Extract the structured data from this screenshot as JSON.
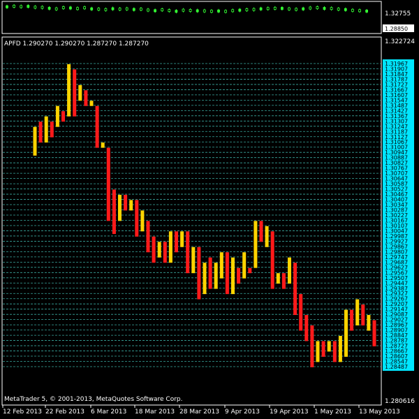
{
  "theme": {
    "background": "#000000",
    "grid": "#3aa9a0",
    "up": "#ffd400",
    "down": "#ff1a1a",
    "indicator_up": "#33ff33",
    "price_axis_bg": "#00e5ff"
  },
  "indicator_panel": {
    "axis_labels": [
      "1.32755",
      "1.28850"
    ],
    "range": [
      1.2865,
      1.3285
    ],
    "values": [
      1.3265,
      1.3275,
      1.3268,
      1.3272,
      1.3258,
      1.3255,
      1.324,
      1.323,
      1.325,
      1.3245,
      1.3235,
      1.3248,
      1.323,
      1.3225,
      1.3218,
      1.3232,
      1.3226,
      1.323,
      1.322,
      1.3225,
      1.321,
      1.32,
      1.3214,
      1.3202,
      1.319,
      1.3208,
      1.3204,
      1.3198,
      1.3196,
      1.319,
      1.3194,
      1.3188,
      1.32,
      1.3208,
      1.3215,
      1.322,
      1.323,
      1.3235,
      1.324,
      1.3238,
      1.323,
      1.3222,
      1.323,
      1.3244,
      1.325,
      1.3238,
      1.3236,
      1.3225,
      1.3218,
      1.3206,
      1.32,
      1.3193
    ]
  },
  "main_panel": {
    "header": "APFD 1.290270 1.290270 1.287270 1.287270",
    "axis_top_label": "1.322724",
    "axis_bottom_label": "1.280616",
    "copyright": "MetaTrader 5, © 2001-2013, MetaQuotes Software Corp."
  },
  "chart_data": {
    "type": "bar",
    "title": "",
    "symbol": "APFD",
    "ylim": [
      1.280616,
      1.322724
    ],
    "price_ticks": [
      "1.31967",
      "1.31907",
      "1.31847",
      "1.31787",
      "1.31727",
      "1.31667",
      "1.31607",
      "1.31547",
      "1.31487",
      "1.31427",
      "1.31367",
      "1.31307",
      "1.31247",
      "1.31187",
      "1.31127",
      "1.31067",
      "1.31007",
      "1.30947",
      "1.30887",
      "1.30827",
      "1.30767",
      "1.30707",
      "1.30647",
      "1.30587",
      "1.30527",
      "1.30467",
      "1.30407",
      "1.30347",
      "1.30287",
      "1.30227",
      "1.30167",
      "1.30107",
      "1.30047",
      "1.29987",
      "1.29927",
      "1.29867",
      "1.29807",
      "1.29747",
      "1.29687",
      "1.29627",
      "1.29567",
      "1.29507",
      "1.29447",
      "1.29387",
      "1.29327",
      "1.29267",
      "1.29207",
      "1.29147",
      "1.29087",
      "1.29027",
      "1.28967",
      "1.28907",
      "1.28847",
      "1.28787",
      "1.28727",
      "1.28667",
      "1.28607",
      "1.28547",
      "1.28487"
    ],
    "date_labels": [
      "12 Feb 2013",
      "22 Feb 2013",
      "6 Mar 2013",
      "18 Mar 2013",
      "28 Mar 2013",
      "9 Apr 2013",
      "19 Apr 2013",
      "1 May 2013",
      "13 May 2013"
    ],
    "series": [
      {
        "dir": "up",
        "lo": 1.3091,
        "hi": 1.3124
      },
      {
        "dir": "down",
        "lo": 1.3106,
        "hi": 1.313
      },
      {
        "dir": "up",
        "lo": 1.3106,
        "hi": 1.3136
      },
      {
        "dir": "down",
        "lo": 1.3112,
        "hi": 1.313
      },
      {
        "dir": "up",
        "lo": 1.3124,
        "hi": 1.3148
      },
      {
        "dir": "down",
        "lo": 1.313,
        "hi": 1.3142
      },
      {
        "dir": "up",
        "lo": 1.3136,
        "hi": 1.3196
      },
      {
        "dir": "down",
        "lo": 1.3136,
        "hi": 1.319
      },
      {
        "dir": "up",
        "lo": 1.3154,
        "hi": 1.3172
      },
      {
        "dir": "down",
        "lo": 1.3148,
        "hi": 1.3166
      },
      {
        "dir": "up",
        "lo": 1.3148,
        "hi": 1.3154
      },
      {
        "dir": "down",
        "lo": 1.31,
        "hi": 1.3148
      },
      {
        "dir": "up",
        "lo": 1.31,
        "hi": 1.3106
      },
      {
        "dir": "down",
        "lo": 1.3016,
        "hi": 1.31
      },
      {
        "dir": "down",
        "lo": 1.3001,
        "hi": 1.3052
      },
      {
        "dir": "up",
        "lo": 1.3016,
        "hi": 1.3046
      },
      {
        "dir": "down",
        "lo": 1.3028,
        "hi": 1.3046
      },
      {
        "dir": "up",
        "lo": 1.3028,
        "hi": 1.304
      },
      {
        "dir": "down",
        "lo": 1.2998,
        "hi": 1.304
      },
      {
        "dir": "up",
        "lo": 1.3004,
        "hi": 1.3028
      },
      {
        "dir": "down",
        "lo": 1.298,
        "hi": 1.3016
      },
      {
        "dir": "down",
        "lo": 1.2968,
        "hi": 1.2998
      },
      {
        "dir": "up",
        "lo": 1.2974,
        "hi": 1.2992
      },
      {
        "dir": "down",
        "lo": 1.2968,
        "hi": 1.2992
      },
      {
        "dir": "up",
        "lo": 1.2968,
        "hi": 1.3004
      },
      {
        "dir": "down",
        "lo": 1.298,
        "hi": 1.3004
      },
      {
        "dir": "up",
        "lo": 1.2986,
        "hi": 1.3004
      },
      {
        "dir": "down",
        "lo": 1.2956,
        "hi": 1.3004
      },
      {
        "dir": "up",
        "lo": 1.2956,
        "hi": 1.2986
      },
      {
        "dir": "down",
        "lo": 1.2926,
        "hi": 1.2986
      },
      {
        "dir": "up",
        "lo": 1.2932,
        "hi": 1.2968
      },
      {
        "dir": "down",
        "lo": 1.2938,
        "hi": 1.2974
      },
      {
        "dir": "up",
        "lo": 1.2938,
        "hi": 1.2968
      },
      {
        "dir": "up",
        "lo": 1.295,
        "hi": 1.298
      },
      {
        "dir": "down",
        "lo": 1.2932,
        "hi": 1.298
      },
      {
        "dir": "up",
        "lo": 1.2932,
        "hi": 1.2974
      },
      {
        "dir": "down",
        "lo": 1.2944,
        "hi": 1.2962
      },
      {
        "dir": "up",
        "lo": 1.295,
        "hi": 1.298
      },
      {
        "dir": "down",
        "lo": 1.2956,
        "hi": 1.2962
      },
      {
        "dir": "up",
        "lo": 1.2962,
        "hi": 1.3016
      },
      {
        "dir": "down",
        "lo": 1.2992,
        "hi": 1.3016
      },
      {
        "dir": "up",
        "lo": 1.2986,
        "hi": 1.301
      },
      {
        "dir": "down",
        "lo": 1.2938,
        "hi": 1.3004
      },
      {
        "dir": "up",
        "lo": 1.2944,
        "hi": 1.2956
      },
      {
        "dir": "down",
        "lo": 1.2938,
        "hi": 1.2956
      },
      {
        "dir": "up",
        "lo": 1.2944,
        "hi": 1.2974
      },
      {
        "dir": "down",
        "lo": 1.2908,
        "hi": 1.2968
      },
      {
        "dir": "down",
        "lo": 1.289,
        "hi": 1.2932
      },
      {
        "dir": "down",
        "lo": 1.2878,
        "hi": 1.2908
      },
      {
        "dir": "down",
        "lo": 1.2848,
        "hi": 1.2896
      },
      {
        "dir": "up",
        "lo": 1.2854,
        "hi": 1.2878
      },
      {
        "dir": "down",
        "lo": 1.286,
        "hi": 1.2878
      },
      {
        "dir": "up",
        "lo": 1.2866,
        "hi": 1.2878
      },
      {
        "dir": "down",
        "lo": 1.2854,
        "hi": 1.2878
      },
      {
        "dir": "up",
        "lo": 1.2854,
        "hi": 1.2884
      },
      {
        "dir": "up",
        "lo": 1.286,
        "hi": 1.2914
      },
      {
        "dir": "down",
        "lo": 1.289,
        "hi": 1.2914
      },
      {
        "dir": "up",
        "lo": 1.2896,
        "hi": 1.2926
      },
      {
        "dir": "down",
        "lo": 1.2896,
        "hi": 1.292
      },
      {
        "dir": "up",
        "lo": 1.289,
        "hi": 1.2908
      },
      {
        "dir": "down",
        "lo": 1.2872,
        "hi": 1.2902
      }
    ]
  }
}
